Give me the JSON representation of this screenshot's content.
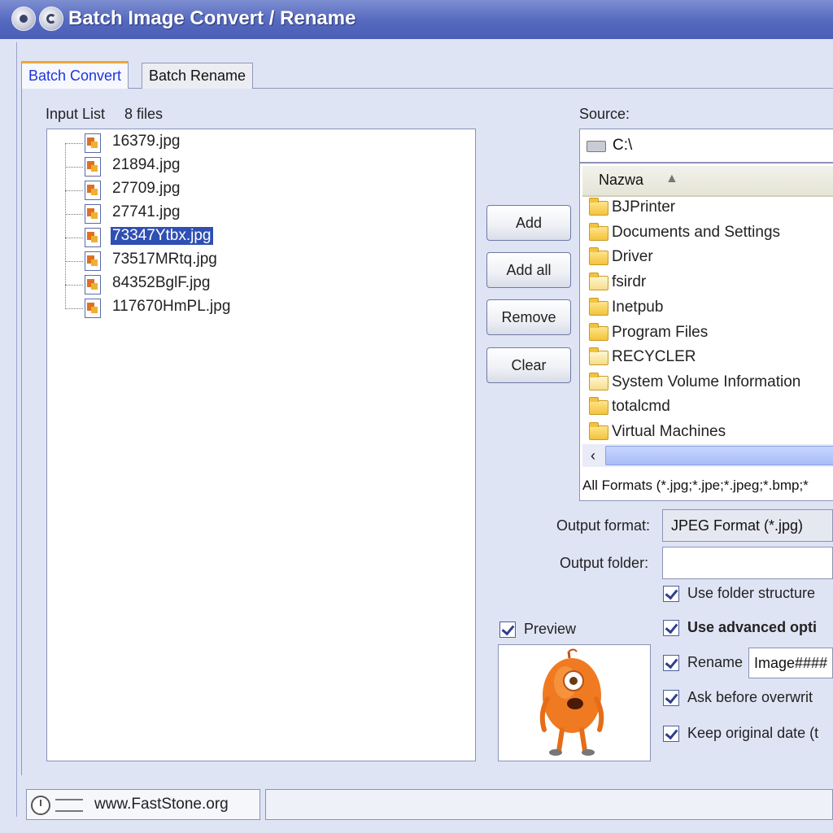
{
  "window": {
    "title": "Batch Image Convert / Rename"
  },
  "tabs": [
    {
      "label": "Batch Convert",
      "active": true
    },
    {
      "label": "Batch Rename",
      "active": false
    }
  ],
  "input_list": {
    "label": "Input List",
    "count": "8 files",
    "files": [
      "16379.jpg",
      "21894.jpg",
      "27709.jpg",
      "27741.jpg",
      "73347Ytbx.jpg",
      "73517MRtq.jpg",
      "84352BglF.jpg",
      "117670HmPL.jpg"
    ],
    "selected_index": 4
  },
  "buttons": {
    "add": "Add",
    "add_all": "Add all",
    "remove": "Remove",
    "clear": "Clear"
  },
  "source": {
    "label": "Source:",
    "path": "C:\\",
    "column_header": "Nazwa",
    "folders": [
      "BJPrinter",
      "Documents and Settings",
      "Driver",
      "fsirdr",
      "Inetpub",
      "Program Files",
      "RECYCLER",
      "System Volume Information",
      "totalcmd",
      "Virtual Machines"
    ],
    "filter": "All Formats (*.jpg;*.jpe;*.jpeg;*.bmp;*"
  },
  "output": {
    "format_label": "Output format:",
    "format_value": "JPEG Format (*.jpg)",
    "folder_label": "Output folder:",
    "folder_value": ""
  },
  "options": {
    "use_folder_structure": "Use folder structure",
    "use_advanced_options": "Use advanced opti",
    "rename": "Rename",
    "rename_value": "Image####",
    "ask_before_overwrite": "Ask before overwrit",
    "keep_original_date": "Keep original date (t"
  },
  "preview": {
    "label": "Preview"
  },
  "status": {
    "website": "www.FastStone.org"
  },
  "colors": {
    "title_bar": "#5468be",
    "selection": "#2f4fb3",
    "tab_accent": "#f0a53b",
    "panel_bg": "#dfe4f5"
  }
}
